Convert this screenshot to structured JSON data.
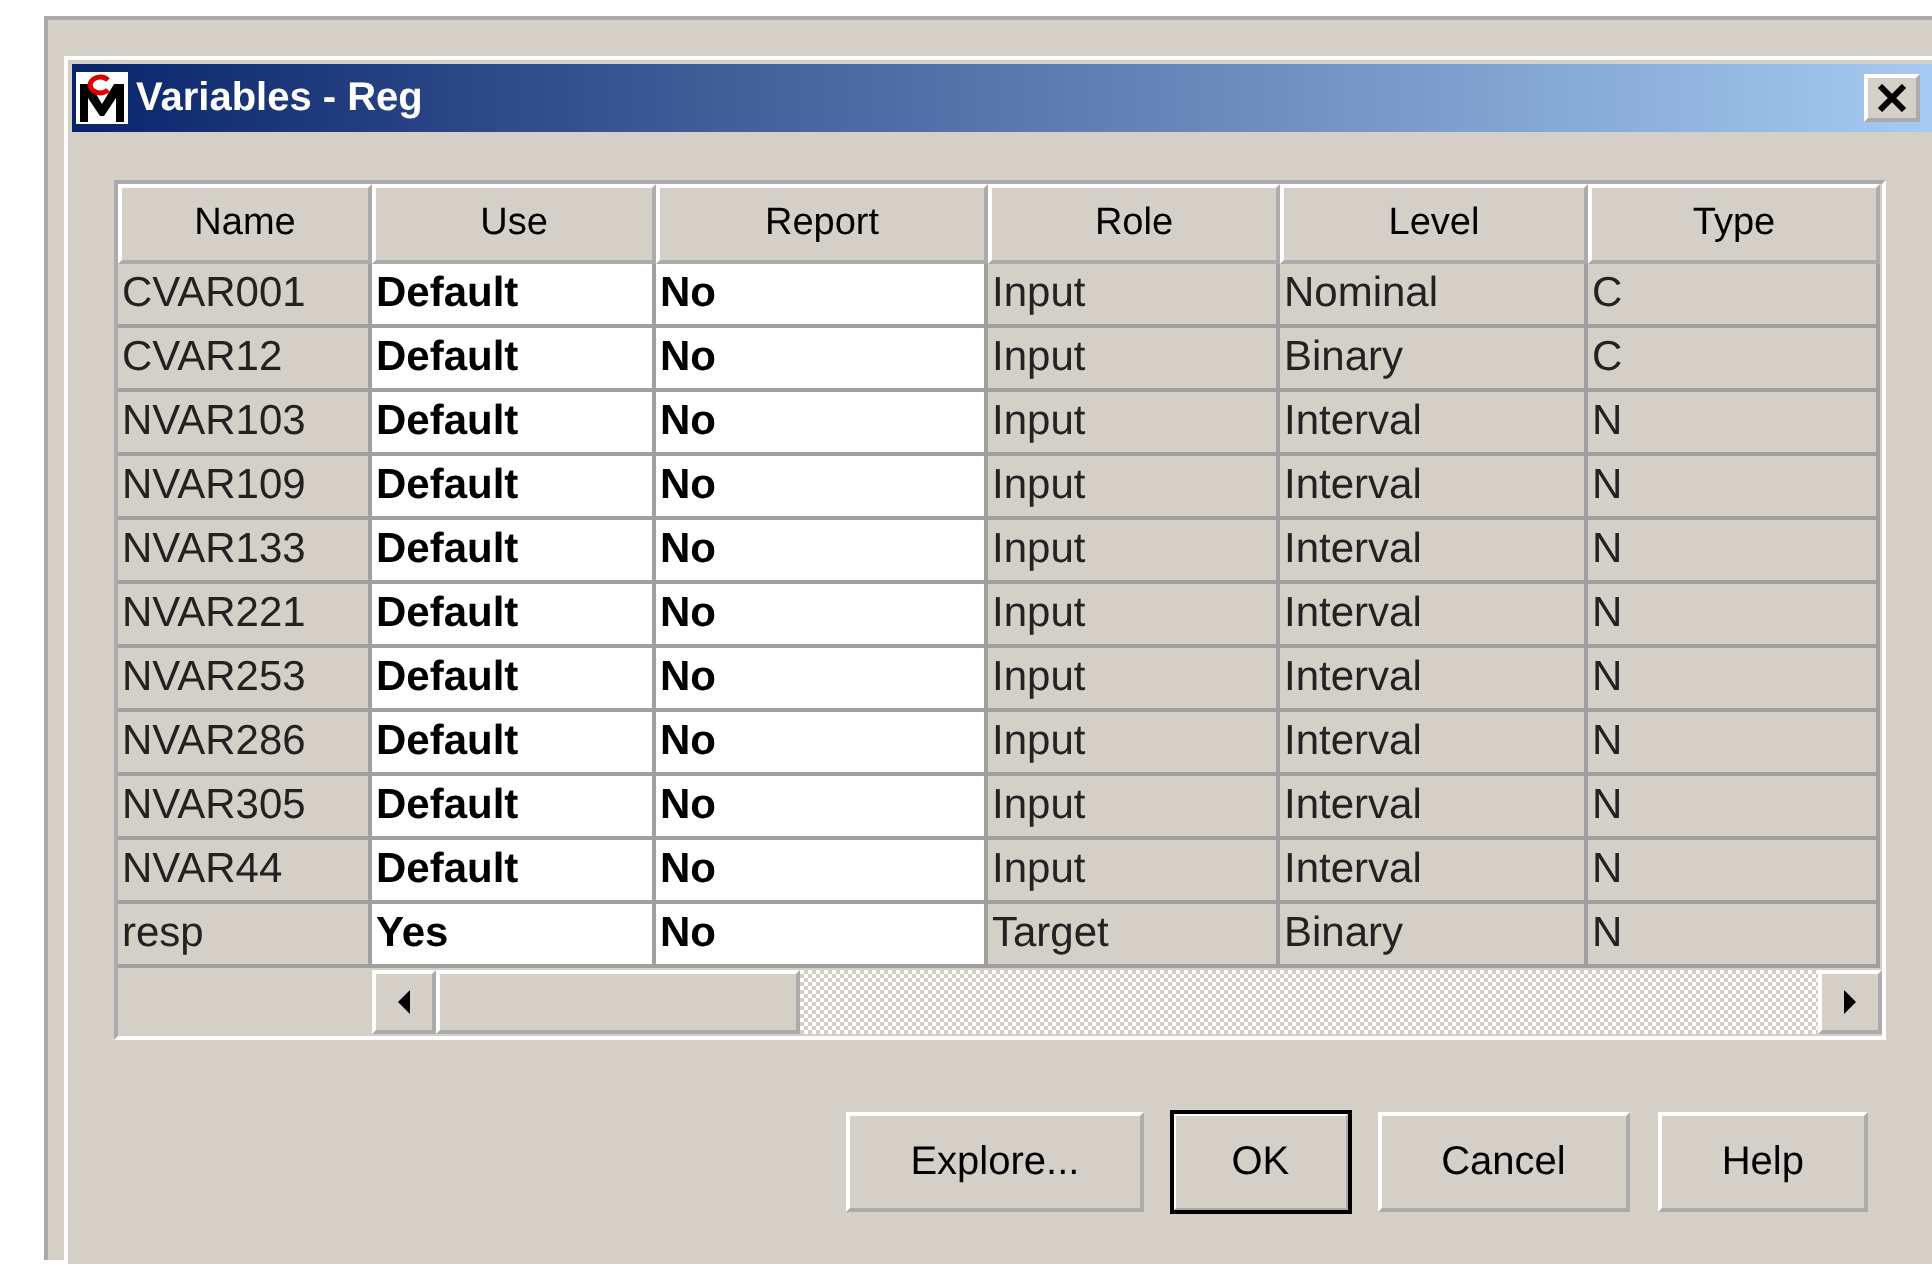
{
  "window": {
    "title": "Variables - Reg"
  },
  "table": {
    "columns": [
      {
        "label": "Name",
        "editable": false
      },
      {
        "label": "Use",
        "editable": true
      },
      {
        "label": "Report",
        "editable": true
      },
      {
        "label": "Role",
        "editable": false
      },
      {
        "label": "Level",
        "editable": false
      },
      {
        "label": "Type",
        "editable": false
      }
    ],
    "rows": [
      [
        "CVAR001",
        "Default",
        "No",
        "Input",
        "Nominal",
        "C"
      ],
      [
        "CVAR12",
        "Default",
        "No",
        "Input",
        "Binary",
        "C"
      ],
      [
        "NVAR103",
        "Default",
        "No",
        "Input",
        "Interval",
        "N"
      ],
      [
        "NVAR109",
        "Default",
        "No",
        "Input",
        "Interval",
        "N"
      ],
      [
        "NVAR133",
        "Default",
        "No",
        "Input",
        "Interval",
        "N"
      ],
      [
        "NVAR221",
        "Default",
        "No",
        "Input",
        "Interval",
        "N"
      ],
      [
        "NVAR253",
        "Default",
        "No",
        "Input",
        "Interval",
        "N"
      ],
      [
        "NVAR286",
        "Default",
        "No",
        "Input",
        "Interval",
        "N"
      ],
      [
        "NVAR305",
        "Default",
        "No",
        "Input",
        "Interval",
        "N"
      ],
      [
        "NVAR44",
        "Default",
        "No",
        "Input",
        "Interval",
        "N"
      ],
      [
        "resp",
        "Yes",
        "No",
        "Target",
        "Binary",
        "N"
      ]
    ]
  },
  "buttons": [
    {
      "label": "Explore...",
      "default": false
    },
    {
      "label": "OK",
      "default": true
    },
    {
      "label": "Cancel",
      "default": false
    },
    {
      "label": "Help",
      "default": false
    }
  ]
}
